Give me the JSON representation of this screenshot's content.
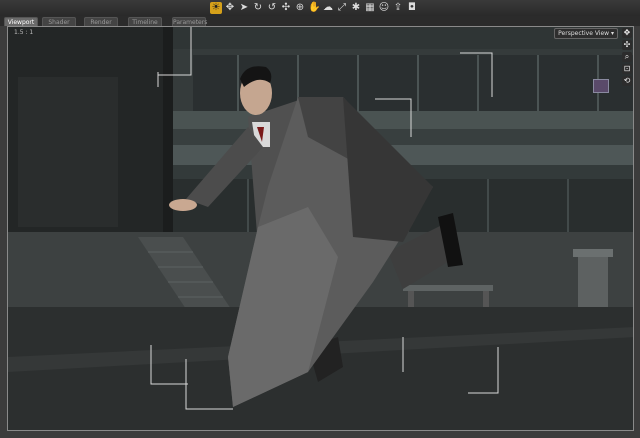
{
  "toolbar": {
    "icons": [
      "camera-icon",
      "move-icon",
      "pointer-icon",
      "rotate-icon",
      "rotate-alt-icon",
      "translate-icon",
      "node-icon",
      "hand-icon",
      "cloth-icon",
      "scale-icon",
      "pose-icon",
      "grid-icon",
      "figure-icon",
      "export-icon",
      "snapshot-icon"
    ],
    "active_index": 0
  },
  "tabs": [
    {
      "label": "Viewport",
      "active": true
    },
    {
      "label": "Shader Editor",
      "active": false
    },
    {
      "label": "Render Editor",
      "active": false
    },
    {
      "label": "Timeline Editor",
      "active": false
    },
    {
      "label": "Parameters",
      "active": false
    }
  ],
  "viewport": {
    "ratio_label": "1.5 : 1",
    "view_menu_label": "Perspective View",
    "view_menu_arrow": "▾"
  },
  "nav_controls": {
    "icons": [
      "orbit-icon",
      "pan-icon",
      "zoom-icon",
      "frame-icon",
      "reset-icon"
    ],
    "glyphs": [
      "✥",
      "✣",
      "⌕",
      "⊡",
      "⟲"
    ]
  },
  "colors": {
    "toolbar_active": "#d6a11a",
    "viewport_bg": "#1b1d1d",
    "building": "#3c4444",
    "ground": "#2c2f2f",
    "suit": "#4a4a4a",
    "cloth": "#5a5a5a"
  }
}
